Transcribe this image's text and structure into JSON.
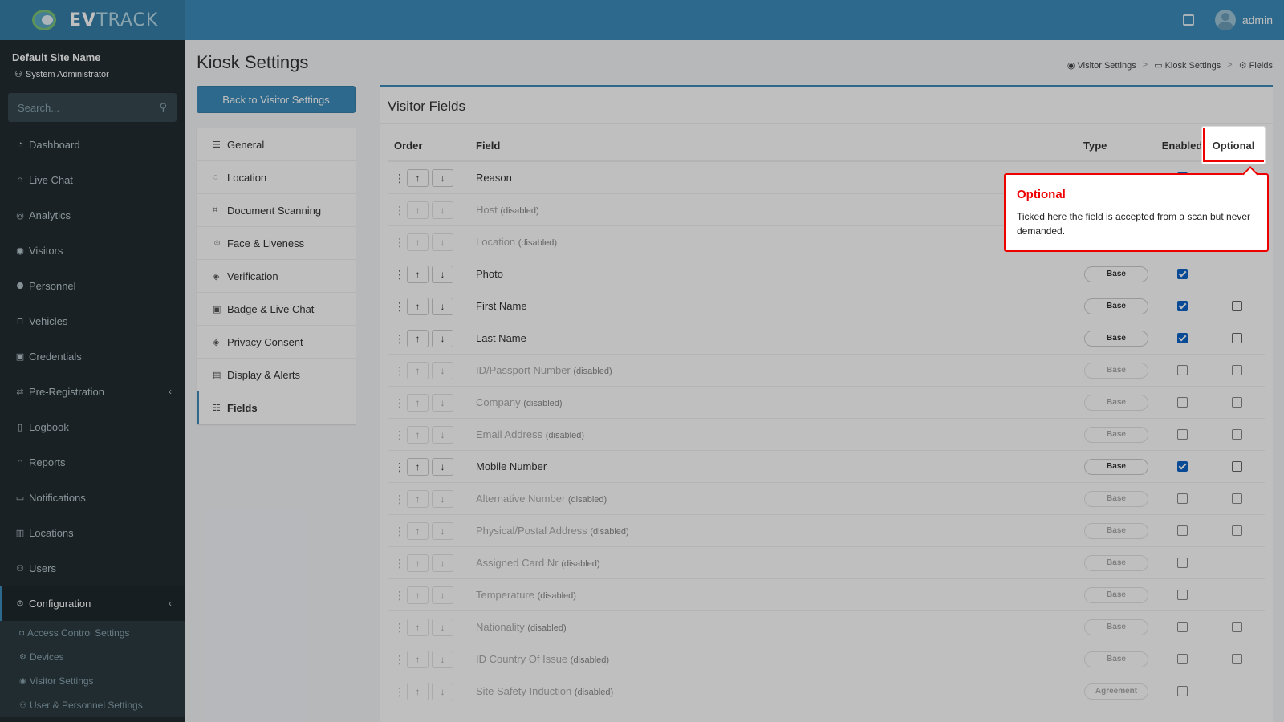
{
  "brand": {
    "name_bold": "EV",
    "name_rest": "TRACK"
  },
  "topbar": {
    "user": "admin"
  },
  "sidebar": {
    "site_name": "Default Site Name",
    "role": "System Administrator",
    "search_placeholder": "Search...",
    "items": [
      {
        "label": "Dashboard",
        "icon": "dashboard-icon"
      },
      {
        "label": "Live Chat",
        "icon": "headset-icon"
      },
      {
        "label": "Analytics",
        "icon": "analytics-icon"
      },
      {
        "label": "Visitors",
        "icon": "eye-icon"
      },
      {
        "label": "Personnel",
        "icon": "personnel-icon"
      },
      {
        "label": "Vehicles",
        "icon": "car-icon"
      },
      {
        "label": "Credentials",
        "icon": "credentials-icon"
      },
      {
        "label": "Pre-Registration",
        "icon": "exchange-icon"
      },
      {
        "label": "Logbook",
        "icon": "book-icon"
      },
      {
        "label": "Reports",
        "icon": "reports-icon"
      },
      {
        "label": "Notifications",
        "icon": "notifications-icon"
      },
      {
        "label": "Locations",
        "icon": "map-icon"
      },
      {
        "label": "Users",
        "icon": "users-icon"
      },
      {
        "label": "Configuration",
        "icon": "gear-icon"
      }
    ],
    "sub_items": [
      {
        "label": "Access Control Settings",
        "icon": "lock-icon"
      },
      {
        "label": "Devices",
        "icon": "devices-icon"
      },
      {
        "label": "Visitor Settings",
        "icon": "eye-icon"
      },
      {
        "label": "User & Personnel Settings",
        "icon": "users-icon"
      }
    ]
  },
  "page": {
    "title": "Kiosk Settings",
    "breadcrumb": [
      "Visitor Settings",
      "Kiosk Settings",
      "Fields"
    ]
  },
  "back_button": "Back to Visitor Settings",
  "settings_menu": [
    {
      "label": "General",
      "icon": "sliders-icon"
    },
    {
      "label": "Location",
      "icon": "pin-icon"
    },
    {
      "label": "Document Scanning",
      "icon": "scan-icon"
    },
    {
      "label": "Face & Liveness",
      "icon": "face-icon"
    },
    {
      "label": "Verification",
      "icon": "shield-icon"
    },
    {
      "label": "Badge & Live Chat",
      "icon": "badge-icon"
    },
    {
      "label": "Privacy Consent",
      "icon": "privacy-icon"
    },
    {
      "label": "Display & Alerts",
      "icon": "display-icon"
    },
    {
      "label": "Fields",
      "icon": "list-check-icon"
    }
  ],
  "panel": {
    "title": "Visitor Fields",
    "headers": {
      "order": "Order",
      "field": "Field",
      "type": "Type",
      "enabled": "Enabled",
      "optional": "Optional"
    },
    "disabled_label": "(disabled)",
    "rows": [
      {
        "field": "Reason",
        "disabled": false,
        "type": "",
        "enabled": true,
        "optional": null
      },
      {
        "field": "Host",
        "disabled": true,
        "type": "",
        "enabled": false,
        "optional": null
      },
      {
        "field": "Location",
        "disabled": true,
        "type": "",
        "enabled": false,
        "optional": null
      },
      {
        "field": "Photo",
        "disabled": false,
        "type": "Base",
        "enabled": true,
        "optional": null
      },
      {
        "field": "First Name",
        "disabled": false,
        "type": "Base",
        "enabled": true,
        "optional": false
      },
      {
        "field": "Last Name",
        "disabled": false,
        "type": "Base",
        "enabled": true,
        "optional": false
      },
      {
        "field": "ID/Passport Number",
        "disabled": true,
        "type": "Base",
        "enabled": false,
        "optional": false
      },
      {
        "field": "Company",
        "disabled": true,
        "type": "Base",
        "enabled": false,
        "optional": false
      },
      {
        "field": "Email Address",
        "disabled": true,
        "type": "Base",
        "enabled": false,
        "optional": false
      },
      {
        "field": "Mobile Number",
        "disabled": false,
        "type": "Base",
        "enabled": true,
        "optional": false
      },
      {
        "field": "Alternative Number",
        "disabled": true,
        "type": "Base",
        "enabled": false,
        "optional": false
      },
      {
        "field": "Physical/Postal Address",
        "disabled": true,
        "type": "Base",
        "enabled": false,
        "optional": false
      },
      {
        "field": "Assigned Card Nr",
        "disabled": true,
        "type": "Base",
        "enabled": false,
        "optional": null
      },
      {
        "field": "Temperature",
        "disabled": true,
        "type": "Base",
        "enabled": false,
        "optional": null
      },
      {
        "field": "Nationality",
        "disabled": true,
        "type": "Base",
        "enabled": false,
        "optional": false
      },
      {
        "field": "ID Country Of Issue",
        "disabled": true,
        "type": "Base",
        "enabled": false,
        "optional": false
      },
      {
        "field": "Site Safety Induction",
        "disabled": true,
        "type": "Agreement",
        "enabled": false,
        "optional": null
      }
    ]
  },
  "tooltip": {
    "title": "Optional",
    "text": "Ticked here the field is accepted from a scan but never demanded."
  },
  "colors": {
    "accent": "#3c8dbc",
    "sidebar": "#222d32",
    "highlight": "#ee0000"
  }
}
